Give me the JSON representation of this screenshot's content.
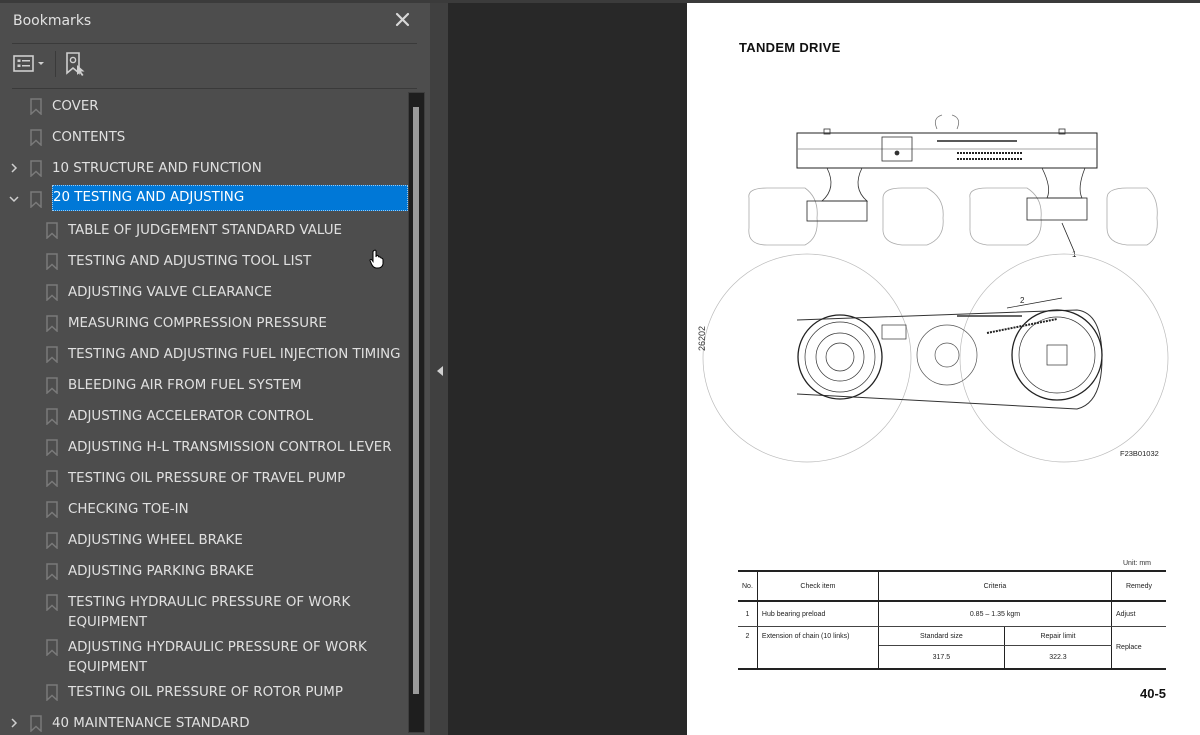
{
  "sidebar": {
    "title": "Bookmarks",
    "close_icon": "close-icon",
    "toolbar": {
      "options_icon": "bookmark-options-icon",
      "find_icon": "find-current-bookmark-icon"
    },
    "items": [
      {
        "label": "COVER",
        "level": 0,
        "expander": "none"
      },
      {
        "label": "CONTENTS",
        "level": 0,
        "expander": "none"
      },
      {
        "label": "10 STRUCTURE AND FUNCTION",
        "level": 0,
        "expander": "collapsed"
      },
      {
        "label": "20 TESTING AND ADJUSTING",
        "level": 0,
        "expander": "expanded",
        "selected": true
      },
      {
        "label": "TABLE OF JUDGEMENT STANDARD VALUE",
        "level": 1
      },
      {
        "label": "TESTING AND ADJUSTING TOOL LIST",
        "level": 1
      },
      {
        "label": "ADJUSTING VALVE CLEARANCE",
        "level": 1
      },
      {
        "label": "MEASURING COMPRESSION PRESSURE",
        "level": 1
      },
      {
        "label": "TESTING AND ADJUSTING FUEL INJECTION TIMING",
        "level": 1
      },
      {
        "label": "BLEEDING AIR FROM FUEL SYSTEM",
        "level": 1
      },
      {
        "label": "ADJUSTING ACCELERATOR CONTROL",
        "level": 1
      },
      {
        "label": "ADJUSTING H-L TRANSMISSION CONTROL LEVER",
        "level": 1
      },
      {
        "label": "TESTING OIL PRESSURE OF TRAVEL PUMP",
        "level": 1
      },
      {
        "label": "CHECKING TOE-IN",
        "level": 1
      },
      {
        "label": "ADJUSTING WHEEL BRAKE",
        "level": 1
      },
      {
        "label": "ADJUSTING PARKING BRAKE",
        "level": 1
      },
      {
        "label": "TESTING HYDRAULIC PRESSURE OF WORK EQUIPMENT",
        "level": 1,
        "line1": "TESTING HYDRAULIC PRESSURE OF WORK",
        "line2": "EQUIPMENT"
      },
      {
        "label": "ADJUSTING HYDRAULIC PRESSURE OF WORK EQUIPMENT",
        "level": 1,
        "line1": "ADJUSTING HYDRAULIC PRESSURE OF WORK",
        "line2": "EQUIPMENT"
      },
      {
        "label": "TESTING OIL PRESSURE OF ROTOR PUMP",
        "level": 1
      },
      {
        "label": "40 MAINTENANCE STANDARD",
        "level": 0,
        "expander": "collapsed"
      }
    ],
    "selected_color": "#0078d7"
  },
  "document": {
    "title": "TANDEM DRIVE",
    "side_code": "26202",
    "figure_code": "F23B01032",
    "callouts": [
      "1",
      "2"
    ],
    "unit": "Unit: mm",
    "table": {
      "headers": [
        "No.",
        "Check item",
        "Criteria",
        "Remedy"
      ],
      "rows": [
        {
          "no": "1",
          "item": "Hub bearing preload",
          "criteria": "0.85 – 1.35 kgm",
          "remedy": "Adjust"
        },
        {
          "no": "2",
          "item": "Extension of chain (10 links)",
          "criteria_headers": [
            "Standard size",
            "Repair limit"
          ],
          "criteria_values": [
            "317.5",
            "322.3"
          ],
          "remedy": "Replace"
        }
      ]
    },
    "page_number": "40-5"
  }
}
